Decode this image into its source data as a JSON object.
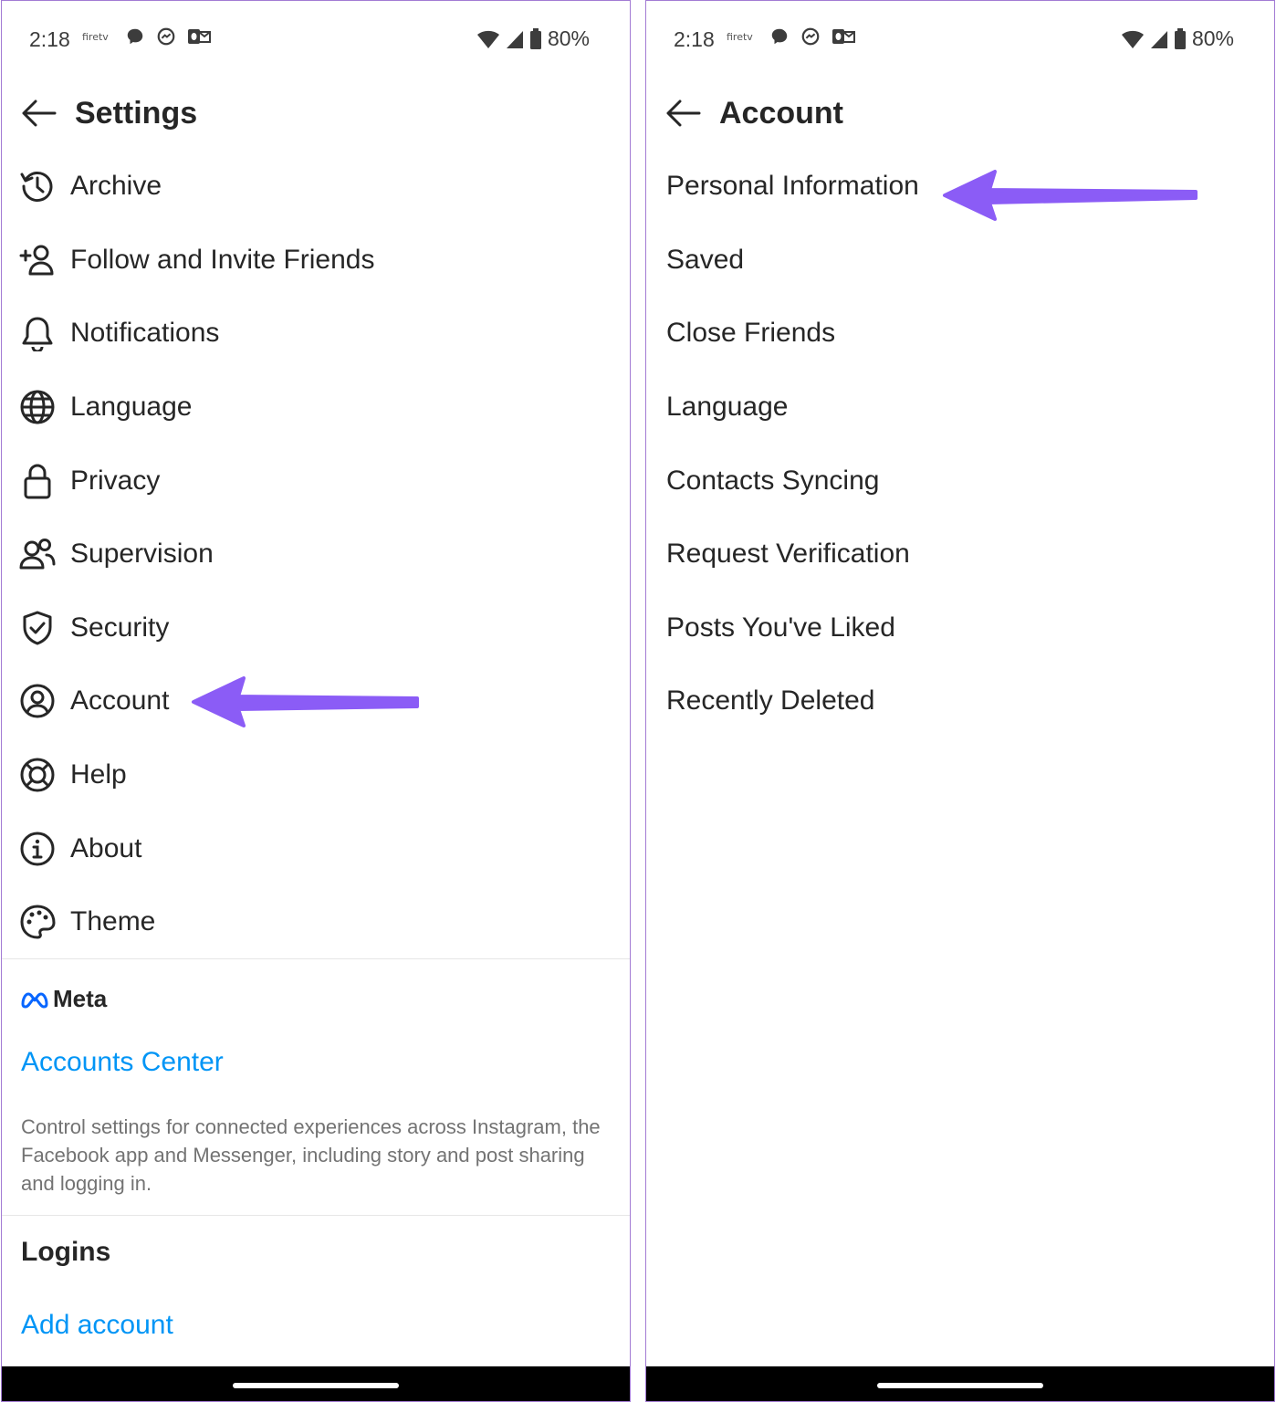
{
  "left_screen": {
    "status": {
      "time": "2:18",
      "notif_firetv": "firetv",
      "battery": "80%"
    },
    "header": {
      "title": "Settings"
    },
    "menu": [
      {
        "label": "Archive",
        "icon": "archive-icon"
      },
      {
        "label": "Follow and Invite Friends",
        "icon": "add-person-icon"
      },
      {
        "label": "Notifications",
        "icon": "bell-icon"
      },
      {
        "label": "Language",
        "icon": "globe-icon"
      },
      {
        "label": "Privacy",
        "icon": "lock-icon"
      },
      {
        "label": "Supervision",
        "icon": "people-icon"
      },
      {
        "label": "Security",
        "icon": "shield-icon"
      },
      {
        "label": "Account",
        "icon": "user-circle-icon"
      },
      {
        "label": "Help",
        "icon": "lifebuoy-icon"
      },
      {
        "label": "About",
        "icon": "info-icon"
      },
      {
        "label": "Theme",
        "icon": "palette-icon"
      }
    ],
    "meta": {
      "brand": "Meta",
      "accounts_center": "Accounts Center",
      "description": "Control settings for connected experiences across Instagram, the Facebook app and Messenger, including story and post sharing and logging in."
    },
    "logins": {
      "heading": "Logins",
      "add_account": "Add account"
    }
  },
  "right_screen": {
    "status": {
      "time": "2:18",
      "notif_firetv": "firetv",
      "battery": "80%"
    },
    "header": {
      "title": "Account"
    },
    "menu": [
      {
        "label": "Personal Information"
      },
      {
        "label": "Saved"
      },
      {
        "label": "Close Friends"
      },
      {
        "label": "Language"
      },
      {
        "label": "Contacts Syncing"
      },
      {
        "label": "Request Verification"
      },
      {
        "label": "Posts You've Liked"
      },
      {
        "label": "Recently Deleted"
      }
    ]
  },
  "colors": {
    "link": "#0095f6",
    "arrow": "#8b5cf6",
    "meta_blue": "#0866ff",
    "frame_border": "#a37bd4"
  }
}
